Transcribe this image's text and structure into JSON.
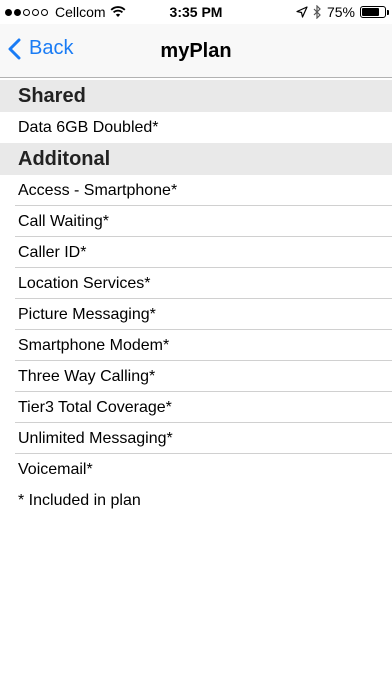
{
  "status_bar": {
    "carrier": "Cellcom",
    "time": "3:35 PM",
    "battery_text": "75%",
    "battery_level": 0.75,
    "signal_dots_filled": 2,
    "signal_dots_total": 5
  },
  "nav": {
    "back_label": "Back",
    "title": "myPlan"
  },
  "sections": [
    {
      "header": "Shared",
      "items": [
        "Data 6GB Doubled*"
      ]
    },
    {
      "header": "Additonal",
      "items": [
        "Access - Smartphone*",
        "Call Waiting*",
        "Caller ID*",
        "Location Services*",
        "Picture Messaging*",
        "Smartphone Modem*",
        "Three Way Calling*",
        "Tier3 Total Coverage*",
        "Unlimited Messaging*",
        "Voicemail*"
      ]
    }
  ],
  "footnote": "* Included in plan",
  "colors": {
    "accent": "#1a7cf5",
    "section_bg": "#e9e9e9",
    "nav_bg": "#f8f8f8"
  }
}
